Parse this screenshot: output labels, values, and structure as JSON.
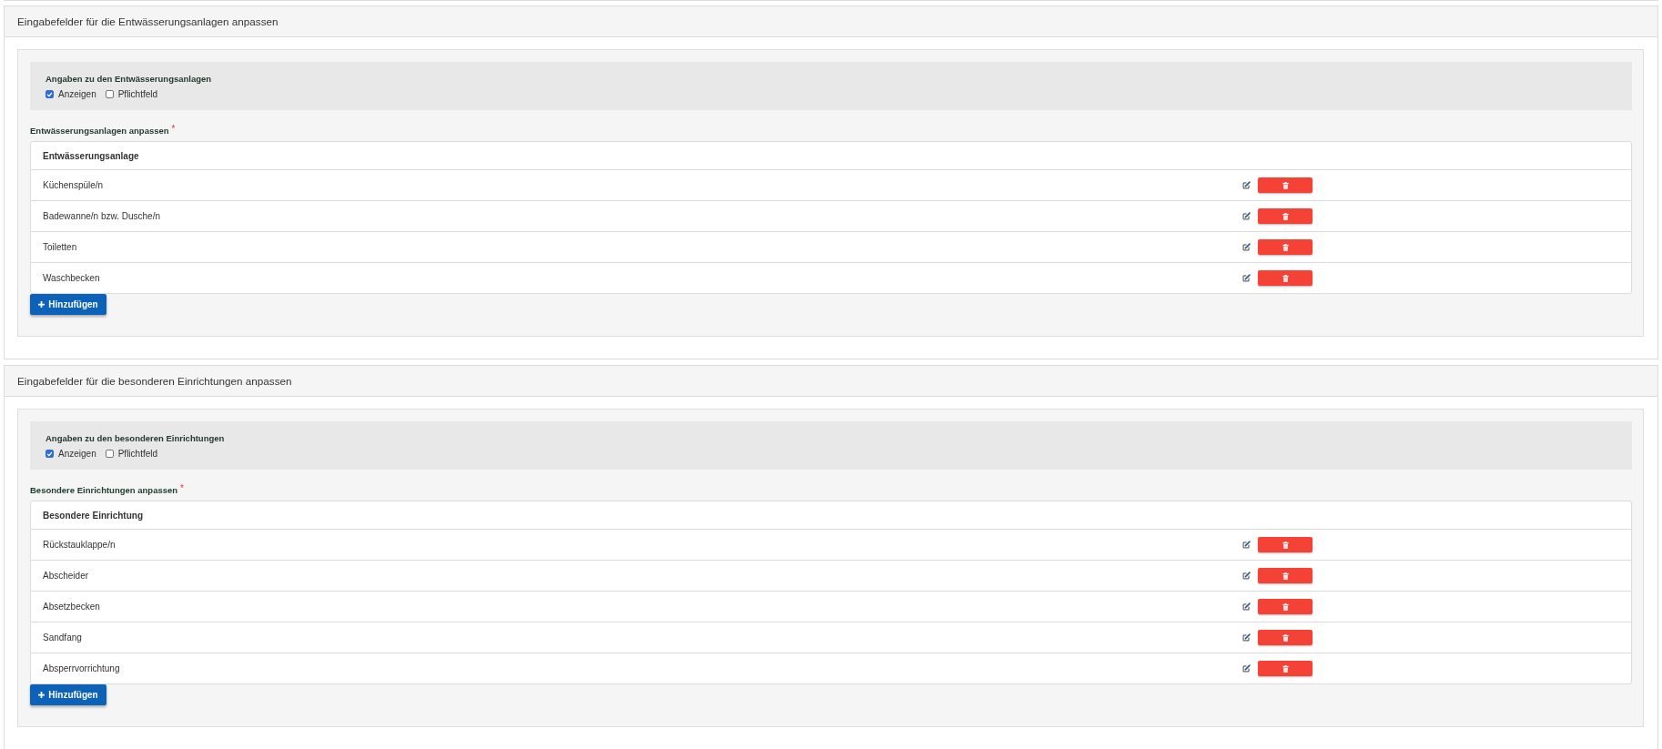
{
  "panels": [
    {
      "title": "Eingabefelder für die Entwässerungsanlagen anpassen",
      "settings": {
        "heading": "Angaben zu den Entwässerungsanlagen",
        "options": [
          {
            "label": "Anzeigen",
            "checked": true
          },
          {
            "label": "Pflichtfeld",
            "checked": false
          }
        ]
      },
      "list_label": "Entwässerungsanlagen anpassen",
      "required_mark": "*",
      "table": {
        "columns": [
          "Entwässerungsanlage"
        ],
        "rows": [
          "Küchenspüle/n",
          "Badewanne/n bzw. Dusche/n",
          "Toiletten",
          "Waschbecken"
        ]
      },
      "add_button": "Hinzufügen"
    },
    {
      "title": "Eingabefelder für die besonderen Einrichtungen anpassen",
      "settings": {
        "heading": "Angaben zu den besonderen Einrichtungen",
        "options": [
          {
            "label": "Anzeigen",
            "checked": true
          },
          {
            "label": "Pflichtfeld",
            "checked": false
          }
        ]
      },
      "list_label": "Besondere Einrichtungen anpassen",
      "required_mark": "*",
      "table": {
        "columns": [
          "Besondere Einrichtung"
        ],
        "rows": [
          "Rückstauklappe/n",
          "Abscheider",
          "Absetzbecken",
          "Sandfang",
          "Absperrvorrichtung"
        ]
      },
      "add_button": "Hinzufügen"
    }
  ]
}
